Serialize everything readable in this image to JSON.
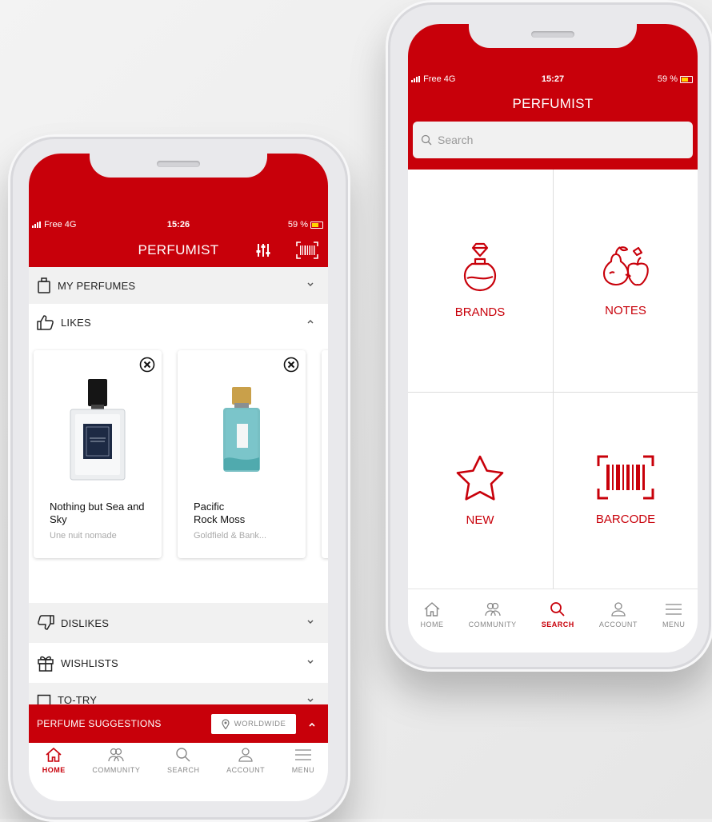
{
  "colors": {
    "brand_red": "#c8000a",
    "gold": "#c9a04a",
    "aqua": "#5fb4b8"
  },
  "left_phone": {
    "status": {
      "carrier": "Free 4G",
      "time": "15:26",
      "battery": "59 %"
    },
    "app_title": "PERFUMIST",
    "header_icons": [
      "filter-sliders-icon",
      "barcode-icon"
    ],
    "sections": {
      "my_perfumes": "MY PERFUMES",
      "likes": "LIKES",
      "dislikes": "DISLIKES",
      "wishlists": "WISHLISTS",
      "to_try": "TO-TRY"
    },
    "likes_cards": [
      {
        "name": "Nothing but Sea and Sky",
        "brand": "Une nuit nomade"
      },
      {
        "name_line1": "Pacific",
        "name_line2": "Rock Moss",
        "brand": "Goldfield & Bank..."
      }
    ],
    "suggestions_bar": {
      "label": "PERFUME SUGGESTIONS",
      "location": "WORLDWIDE"
    },
    "bottom_nav": [
      {
        "label": "HOME",
        "icon": "home-icon",
        "active": true
      },
      {
        "label": "COMMUNITY",
        "icon": "community-icon"
      },
      {
        "label": "SEARCH",
        "icon": "search-icon"
      },
      {
        "label": "ACCOUNT",
        "icon": "account-icon"
      },
      {
        "label": "MENU",
        "icon": "menu-icon"
      }
    ]
  },
  "right_phone": {
    "status": {
      "carrier": "Free 4G",
      "time": "15:27",
      "battery": "59 %"
    },
    "app_title": "PERFUMIST",
    "search_placeholder": "Search",
    "tiles": [
      {
        "label": "BRANDS",
        "icon": "perfume-bottle-diamond-icon"
      },
      {
        "label": "NOTES",
        "icon": "fruits-icon"
      },
      {
        "label": "NEW",
        "icon": "star-icon"
      },
      {
        "label": "BARCODE",
        "icon": "barcode-icon"
      }
    ],
    "bottom_nav": [
      {
        "label": "HOME",
        "icon": "home-icon"
      },
      {
        "label": "COMMUNITY",
        "icon": "community-icon"
      },
      {
        "label": "SEARCH",
        "icon": "search-icon",
        "active": true
      },
      {
        "label": "ACCOUNT",
        "icon": "account-icon"
      },
      {
        "label": "MENU",
        "icon": "menu-icon"
      }
    ]
  }
}
